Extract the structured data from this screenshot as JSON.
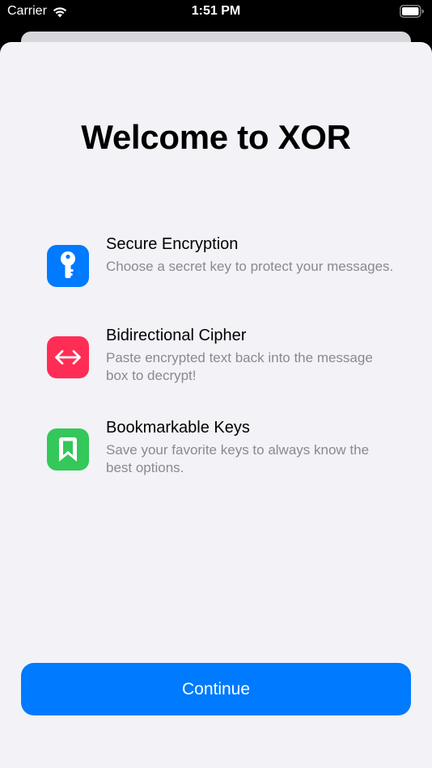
{
  "status_bar": {
    "carrier": "Carrier",
    "time": "1:51 PM"
  },
  "welcome": {
    "title": "Welcome to XOR"
  },
  "features": [
    {
      "icon": "key-icon",
      "color": "#007aff",
      "title": "Secure Encryption",
      "description": "Choose a secret key to protect your messages."
    },
    {
      "icon": "left-right-arrow-icon",
      "color": "#ff2d55",
      "title": "Bidirectional Cipher",
      "description": "Paste encrypted text back into the message box to decrypt!"
    },
    {
      "icon": "bookmark-icon",
      "color": "#34c759",
      "title": "Bookmarkable Keys",
      "description": "Save your favorite keys to always know the best options."
    }
  ],
  "continue_button": {
    "label": "Continue",
    "color": "#007aff"
  }
}
